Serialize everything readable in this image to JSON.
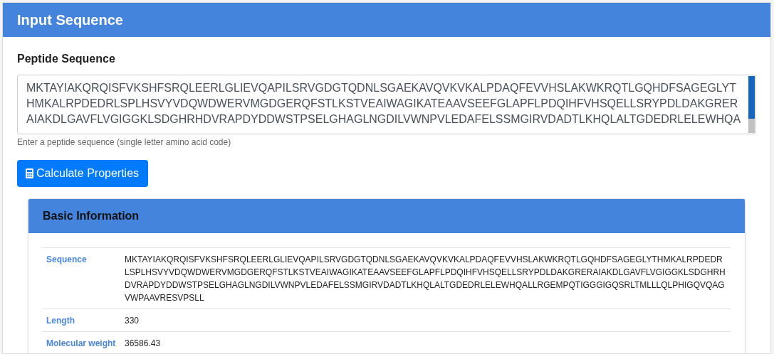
{
  "panel": {
    "title": "Input Sequence"
  },
  "input": {
    "label": "Peptide Sequence",
    "lines": [
      "MKTAYIAKQRQISFVKSHFSRQLEERLGLIEVQAPILSRVGDGTQDNLSGAEKAVQVKVKALPDAQFEVVHSLAKWKRQTLGQHDFSAGEGLYT",
      "HMKALRPDEDRLSPLHSVYVDQWDWERVMGDGERQFSTLKSTVEAIWAGIKATEAAVSEEFGLAPFLPDQIHFVHSQELLSRYPDLDAKGRER",
      "AIAKDLGAVFLVGIGGKLSDGHRHDVRAPDYDDWSTPSELGHAGLNGDILVWNPVLEDAFELSSMGIRVDADTLKHQLALTGDEDRLELEWHQA"
    ],
    "help": "Enter a peptide sequence (single letter amino acid code)"
  },
  "button": {
    "label": "Calculate Properties"
  },
  "card": {
    "title": "Basic Information",
    "rows": [
      {
        "label": "Sequence",
        "value": "MKTAYIAKQRQISFVKSHFSRQLEERLGLIEVQAPILSRVGDGTQDNLSGAEKAVQVKVKALPDAQFEVVHSLAKWKRQTLGQHDFSAGEGLYTHMKALRPDEDRLSPLHSVYVDQWDWERVMGDGERQFSTLKSTVEAIWAGIKATEAAVSEEFGLAPFLPDQIHFVHSQELLSRYPDLDAKGRERAIAKDLGAVFLVGIGGKLSDGHRHDVRAPDYDDWSTPSELGHAGLNGDILVWNPVLEDAFELSSMGIRVDADTLKHQLALTGDEDRLELEWHQALLRGEMPQTIGGGIGQSRLTMLLLQLPHIGQVQAGVWPAAVRESVPSLL"
      },
      {
        "label": "Length",
        "value": "330"
      },
      {
        "label": "Molecular weight",
        "value": "36586.43"
      }
    ]
  }
}
